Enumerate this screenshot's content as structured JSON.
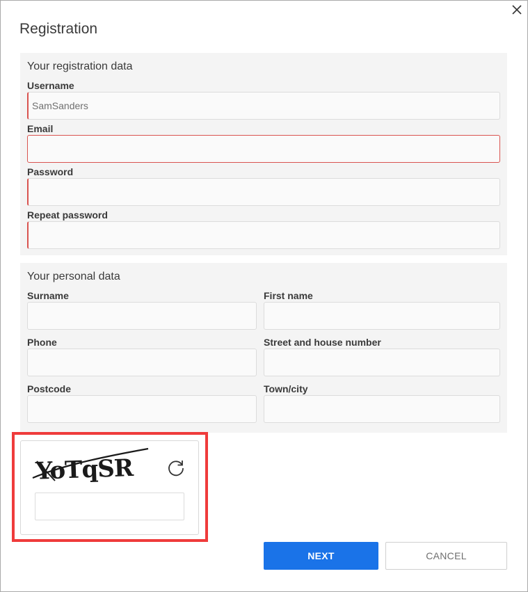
{
  "dialog": {
    "title": "Registration"
  },
  "registration": {
    "section_title": "Your registration data",
    "username": {
      "label": "Username",
      "value": "SamSanders"
    },
    "email": {
      "label": "Email",
      "value": ""
    },
    "password": {
      "label": "Password",
      "value": ""
    },
    "repeat_password": {
      "label": "Repeat password",
      "value": ""
    }
  },
  "personal": {
    "section_title": "Your personal data",
    "surname": {
      "label": "Surname",
      "value": ""
    },
    "first_name": {
      "label": "First name",
      "value": ""
    },
    "phone": {
      "label": "Phone",
      "value": ""
    },
    "street": {
      "label": "Street and house number",
      "value": ""
    },
    "postcode": {
      "label": "Postcode",
      "value": ""
    },
    "town": {
      "label": "Town/city",
      "value": ""
    }
  },
  "captcha": {
    "text": "YoTqSR",
    "input_value": ""
  },
  "buttons": {
    "next": "NEXT",
    "cancel": "CANCEL"
  },
  "colors": {
    "primary": "#1a73e8",
    "error": "#d9534f",
    "highlight": "#ef3b3b"
  },
  "icons": {
    "close": "close-icon",
    "refresh": "refresh-icon"
  }
}
